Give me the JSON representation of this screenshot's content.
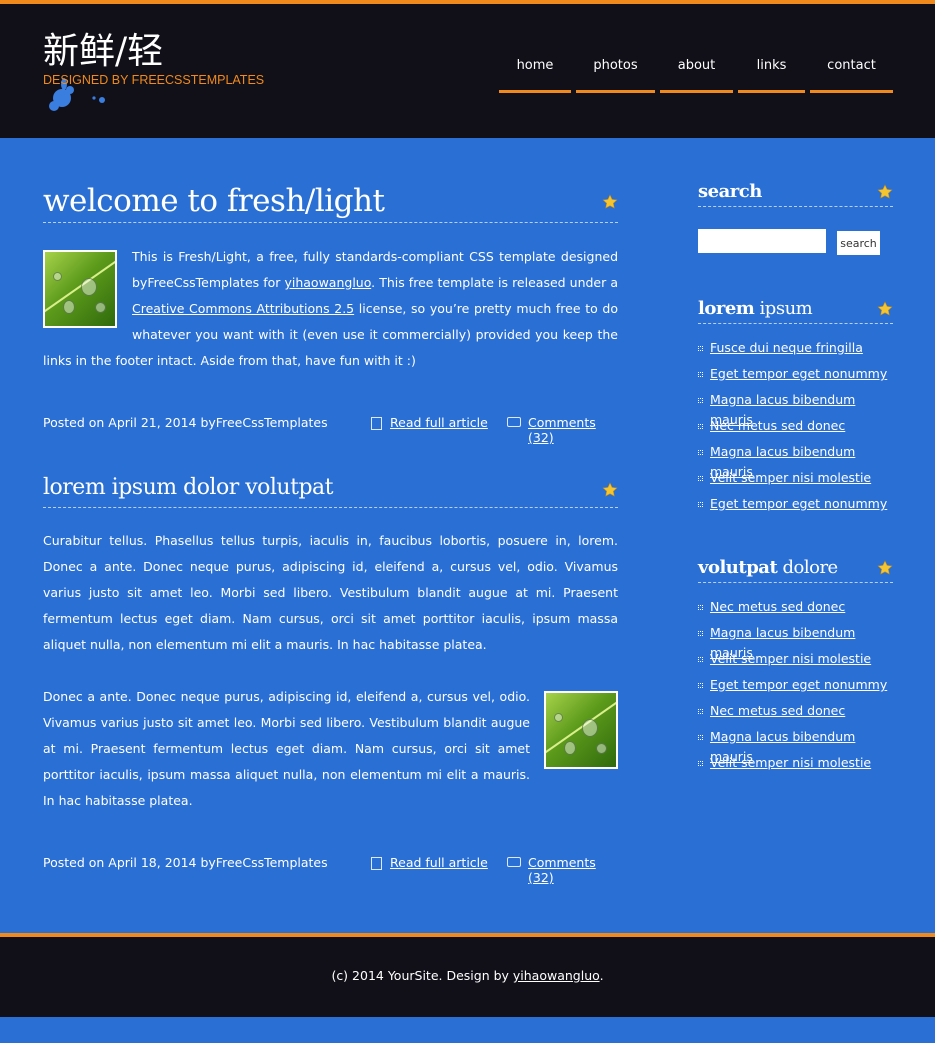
{
  "header": {
    "logo_title": "新鲜/轻",
    "logo_subtitle": "DESIGNED BY FREECSSTEMPLATES"
  },
  "nav": {
    "items": [
      {
        "label": "home"
      },
      {
        "label": "photos"
      },
      {
        "label": "about"
      },
      {
        "label": "links"
      },
      {
        "label": "contact"
      }
    ]
  },
  "posts": [
    {
      "title": "welcome to fresh/light",
      "text_a": "This is Fresh/Light, a free, fully standards-compliant CSS template designed byFreeCssTemplates for ",
      "link_a": "yihaowangluo",
      "text_b": ". This free template is released under a ",
      "link_b": "Creative Commons Attributions 2.5",
      "text_c": " license, so you’re pretty much free to do whatever you want with it (even use it commercially) provided you keep the links in the footer intact. Aside from that, have fun with it :)",
      "posted": "Posted on April 21, 2014 byFreeCssTemplates",
      "read_more": "Read full article",
      "comments": "Comments (32)"
    },
    {
      "title": "lorem ipsum dolor volutpat",
      "para1": "Curabitur tellus. Phasellus tellus turpis, iaculis in, faucibus lobortis, posuere in, lorem. Donec a ante. Donec neque purus, adipiscing id, eleifend a, cursus vel, odio. Vivamus varius justo sit amet leo. Morbi sed libero. Vestibulum blandit augue at mi. Praesent fermentum lectus eget diam. Nam cursus, orci sit amet porttitor iaculis, ipsum massa aliquet nulla, non elementum mi elit a mauris. In hac habitasse platea.",
      "para2": "Donec a ante. Donec neque purus, adipiscing id, eleifend a, cursus vel, odio. Vivamus varius justo sit amet leo. Morbi sed libero. Vestibulum blandit augue at mi. Praesent fermentum lectus eget diam. Nam cursus, orci sit amet porttitor iaculis, ipsum massa aliquet nulla, non elementum mi elit a mauris. In hac habitasse platea.",
      "posted": "Posted on April 18, 2014 byFreeCssTemplates",
      "read_more": "Read full article",
      "comments": "Comments (32)"
    }
  ],
  "sidebar": {
    "search": {
      "title": "search",
      "button_label": "search",
      "value": "",
      "placeholder": ""
    },
    "box1": {
      "title_bold": "lorem",
      "title_rest": " ipsum",
      "links": [
        "Fusce dui neque fringilla",
        "Eget tempor eget nonummy",
        "Magna lacus bibendum mauris",
        "Nec metus sed donec",
        "Magna lacus bibendum mauris",
        "Velit semper nisi molestie",
        "Eget tempor eget nonummy"
      ]
    },
    "box2": {
      "title_bold": "volutpat",
      "title_rest": " dolore",
      "links": [
        "Nec metus sed donec",
        "Magna lacus bibendum mauris",
        "Velit semper nisi molestie",
        "Eget tempor eget nonummy",
        "Nec metus sed donec",
        "Magna lacus bibendum mauris",
        "Velit semper nisi molestie"
      ]
    }
  },
  "footer": {
    "text_a": "(c) 2014 YourSite. Design by ",
    "link": "yihaowangluo",
    "text_b": "."
  },
  "colors": {
    "background": "#2a6fd3",
    "header_bg": "#111018",
    "accent_orange": "#f08a1c",
    "star_yellow": "#f5c431"
  },
  "icons": [
    "star-icon",
    "document-icon",
    "comment-bubble-icon",
    "list-bullet-icon",
    "ink-splash-logo"
  ]
}
